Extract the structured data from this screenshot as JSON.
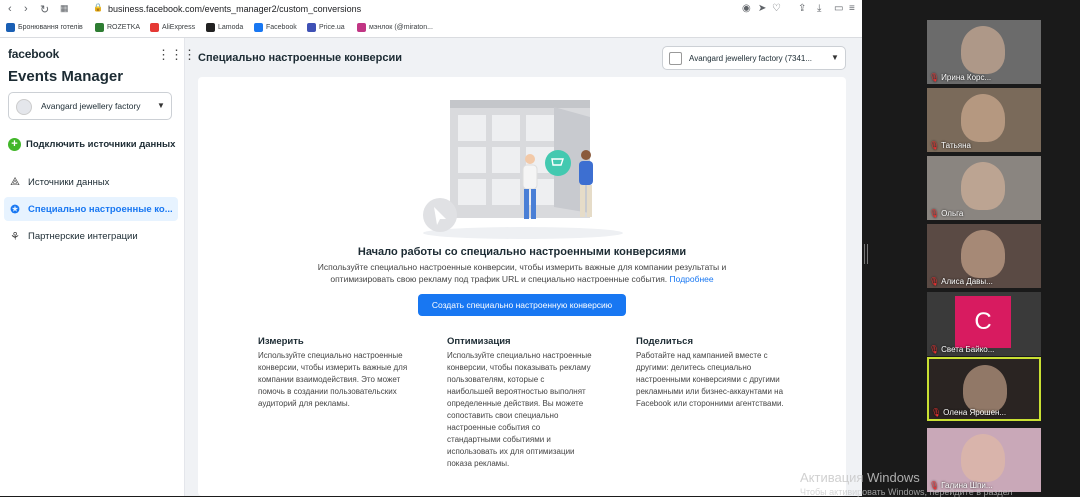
{
  "browser": {
    "url_domain": "business.facebook.com",
    "url_path": "/events_manager2/custom_conversions",
    "bookmarks": [
      {
        "label": "Бронювання готелів",
        "color": "#1a5fb4"
      },
      {
        "label": "ROZETKA",
        "color": "#2e7d32"
      },
      {
        "label": "AliExpress",
        "color": "#e53935"
      },
      {
        "label": "Lamoda",
        "color": "#222222"
      },
      {
        "label": "Facebook",
        "color": "#1877f2"
      },
      {
        "label": "Price.ua",
        "color": "#3f51b5"
      },
      {
        "label": "мэнлок (@miraton...",
        "color": "#c13584"
      }
    ]
  },
  "sidebar": {
    "brand": "facebook",
    "app_title": "Events Manager",
    "account_name": "Avangard jewellery factory",
    "connect_label": "Подключить источники данных",
    "items": [
      {
        "label": "Источники данных",
        "icon": "nodes-icon"
      },
      {
        "label": "Специально настроенные ко...",
        "icon": "star-badge-icon"
      },
      {
        "label": "Партнерские интеграции",
        "icon": "handshake-icon"
      }
    ]
  },
  "header": {
    "title": "Специально настроенные конверсии",
    "account_select": "Avangard jewellery factory (7341..."
  },
  "hero": {
    "title": "Начало работы со специально настроенными конверсиями",
    "desc": "Используйте специально настроенные конверсии, чтобы измерить важные для компании результаты и оптимизировать свою рекламу под трафик URL и специально настроенные события.",
    "link": "Подробнее",
    "button": "Создать специально настроенную конверсию"
  },
  "columns": [
    {
      "title": "Измерить",
      "text": "Используйте специально настроенные конверсии, чтобы измерить важные для компании взаимодействия. Это может помочь в создании пользовательских аудиторий для рекламы."
    },
    {
      "title": "Оптимизация",
      "text": "Используйте специально настроенные конверсии, чтобы показывать рекламу пользователям, которые с наибольшей вероятностью выполнят определенные действия. Вы можете сопоставить свои специально настроенные события со стандартными событиями и использовать их для оптимизации показа рекламы."
    },
    {
      "title": "Поделиться",
      "text": "Работайте над кампанией вместе с другими: делитесь специально настроенными конверсиями с другими рекламными или бизнес-аккаунтами на Facebook или сторонними агентствами."
    }
  ],
  "watermark": {
    "line1": "Активация Windows",
    "line2": "Чтобы активировать Windows, перейдите в раздел"
  },
  "participants": [
    {
      "name": "Ирина Корс...",
      "bg": "#6b6b6b"
    },
    {
      "name": "Татьяна",
      "bg": "#7a6a5a"
    },
    {
      "name": "Ольга",
      "bg": "#8a8580"
    },
    {
      "name": "Алиса Давы...",
      "bg": "#5a4a44"
    },
    {
      "name": "Света Байко...",
      "bg": "#3a3a3a",
      "initial": "С"
    },
    {
      "name": "Олена Ярошен...",
      "bg": "#2a2422",
      "active": true
    },
    {
      "name": "Галина Шпи...",
      "bg": "#c9a8b8"
    }
  ]
}
